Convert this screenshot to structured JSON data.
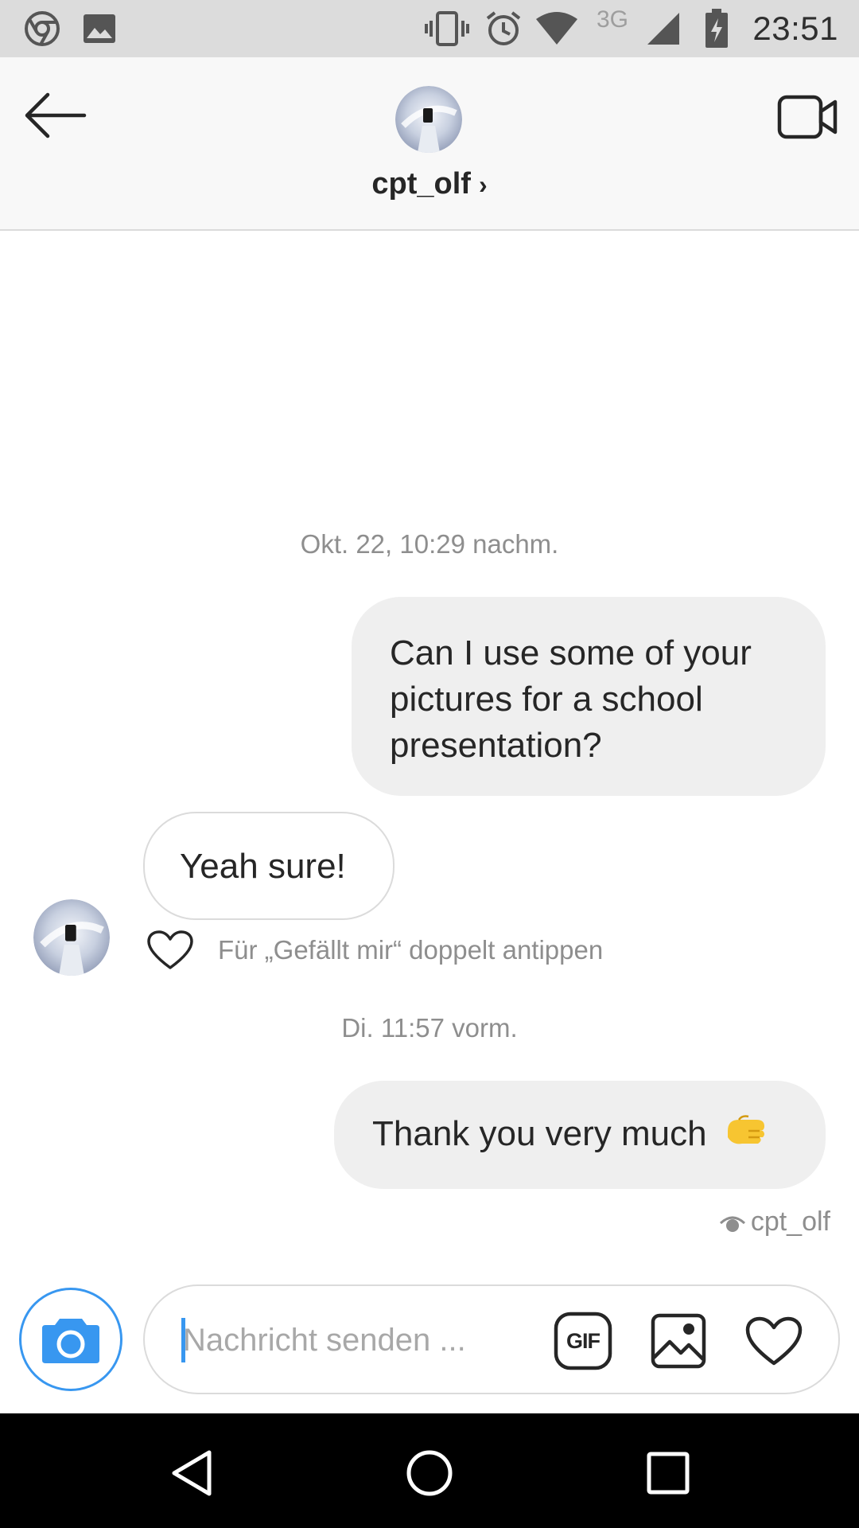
{
  "status_bar": {
    "time": "23:51",
    "network": "3G",
    "icons": [
      "chrome-icon",
      "gallery-icon",
      "vibrate-icon",
      "alarm-icon",
      "wifi-icon",
      "signal-icon",
      "battery-charging-icon"
    ]
  },
  "header": {
    "username": "cpt_olf",
    "chevron": "›",
    "icons": [
      "back-arrow-icon",
      "video-call-icon"
    ]
  },
  "messages": {
    "timestamp_1": "Okt. 22, 10:29 nachm.",
    "outgoing_1_lines": [
      "Can I use some of your",
      "pictures for a school",
      "presentation?"
    ],
    "incoming_1": "Yeah sure!",
    "like_hint": "Für „Gefällt mir“ doppelt antippen",
    "timestamp_2": "Di. 11:57 vorm.",
    "outgoing_2": "Thank you very much",
    "outgoing_2_emoji": "🫱",
    "seen_by": "cpt_olf"
  },
  "composer": {
    "placeholder": "Nachricht senden ...",
    "value": "",
    "gif_label": "GIF",
    "icons": [
      "camera-icon",
      "gif-icon",
      "gallery-icon",
      "heart-icon"
    ]
  },
  "colors": {
    "accent": "#3897f0",
    "bubble_out": "#efefef",
    "secondary_text": "#8e8e8e",
    "emoji_fist": "#f7c531"
  },
  "nav_bar": {
    "icons": [
      "nav-back-icon",
      "nav-home-icon",
      "nav-recents-icon"
    ]
  }
}
